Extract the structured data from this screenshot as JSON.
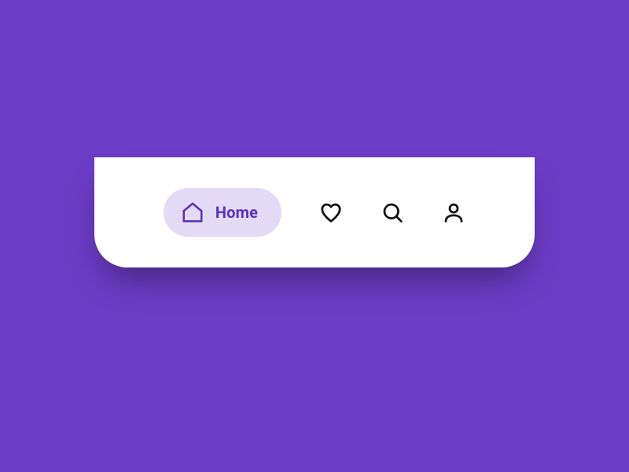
{
  "colors": {
    "background": "#6c3cc6",
    "nav_bg": "#ffffff",
    "active_bg": "#e3daf5",
    "active_fg": "#5c30b5",
    "icon_stroke": "#111111"
  },
  "nav": {
    "items": [
      {
        "id": "home",
        "label": "Home",
        "icon": "home-icon",
        "active": true
      },
      {
        "id": "likes",
        "label": "Likes",
        "icon": "heart-icon",
        "active": false
      },
      {
        "id": "search",
        "label": "Search",
        "icon": "search-icon",
        "active": false
      },
      {
        "id": "profile",
        "label": "Profile",
        "icon": "user-icon",
        "active": false
      }
    ]
  }
}
